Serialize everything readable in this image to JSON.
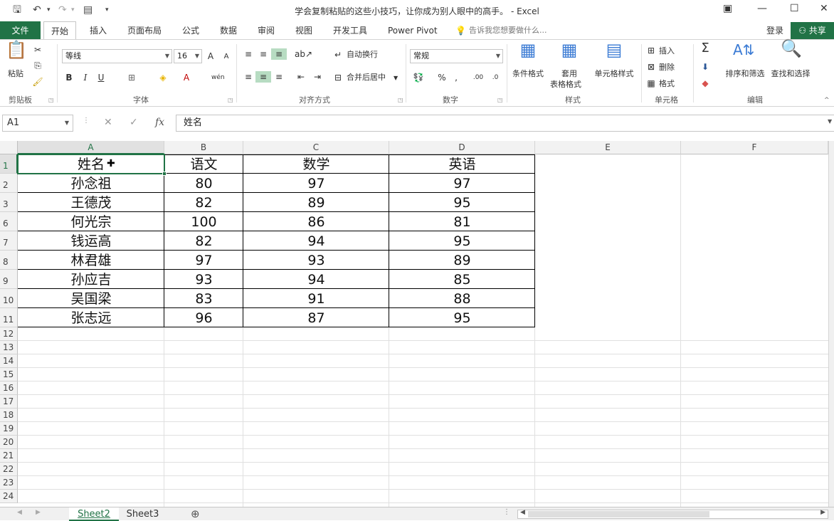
{
  "window": {
    "title": "学会复制粘贴的这些小技巧，让你成为别人眼中的高手。 - Excel"
  },
  "ribbon_tabs": {
    "file": "文件",
    "home": "开始",
    "insert": "插入",
    "layout": "页面布局",
    "formulas": "公式",
    "data": "数据",
    "review": "审阅",
    "view": "视图",
    "developer": "开发工具",
    "powerpivot": "Power Pivot",
    "tell": "告诉我您想要做什么...",
    "login": "登录",
    "share": "共享"
  },
  "ribbon": {
    "paste": "粘贴",
    "font_name": "等线",
    "font_size": "16",
    "wrap": "自动换行",
    "merge": "合并后居中",
    "number_format": "常规",
    "cond_format": "条件格式",
    "table_format_1": "套用",
    "table_format_2": "表格格式",
    "cell_style": "单元格样式",
    "insert": "插入",
    "delete": "删除",
    "format": "格式",
    "sort": "排序和筛选",
    "find": "查找和选择",
    "groups": {
      "clipboard": "剪贴板",
      "font": "字体",
      "align": "对齐方式",
      "number": "数字",
      "styles": "样式",
      "cells": "单元格",
      "edit": "编辑"
    }
  },
  "formula": {
    "namebox": "A1",
    "content": "姓名"
  },
  "columns": [
    "A",
    "B",
    "C",
    "D",
    "E",
    "F"
  ],
  "rows": [
    {
      "num": "1",
      "cells": [
        "姓名",
        "语文",
        "数学",
        "英语"
      ]
    },
    {
      "num": "2",
      "cells": [
        "孙念祖",
        "80",
        "97",
        "97"
      ]
    },
    {
      "num": "3",
      "cells": [
        "王德茂",
        "82",
        "89",
        "95"
      ]
    },
    {
      "num": "6",
      "cells": [
        "何光宗",
        "100",
        "86",
        "81"
      ]
    },
    {
      "num": "7",
      "cells": [
        "钱运高",
        "82",
        "94",
        "95"
      ]
    },
    {
      "num": "8",
      "cells": [
        "林君雄",
        "97",
        "93",
        "89"
      ]
    },
    {
      "num": "9",
      "cells": [
        "孙应吉",
        "93",
        "94",
        "85"
      ]
    },
    {
      "num": "10",
      "cells": [
        "吴国梁",
        "83",
        "91",
        "88"
      ]
    },
    {
      "num": "11",
      "cells": [
        "张志远",
        "96",
        "87",
        "95"
      ]
    }
  ],
  "empty_rows": [
    "12",
    "13",
    "14",
    "15",
    "16",
    "17",
    "18",
    "19",
    "20",
    "21",
    "22",
    "23",
    "24"
  ],
  "sheets": [
    "Sheet2",
    "Sheet3"
  ],
  "colors": {
    "excel_green": "#217346"
  }
}
